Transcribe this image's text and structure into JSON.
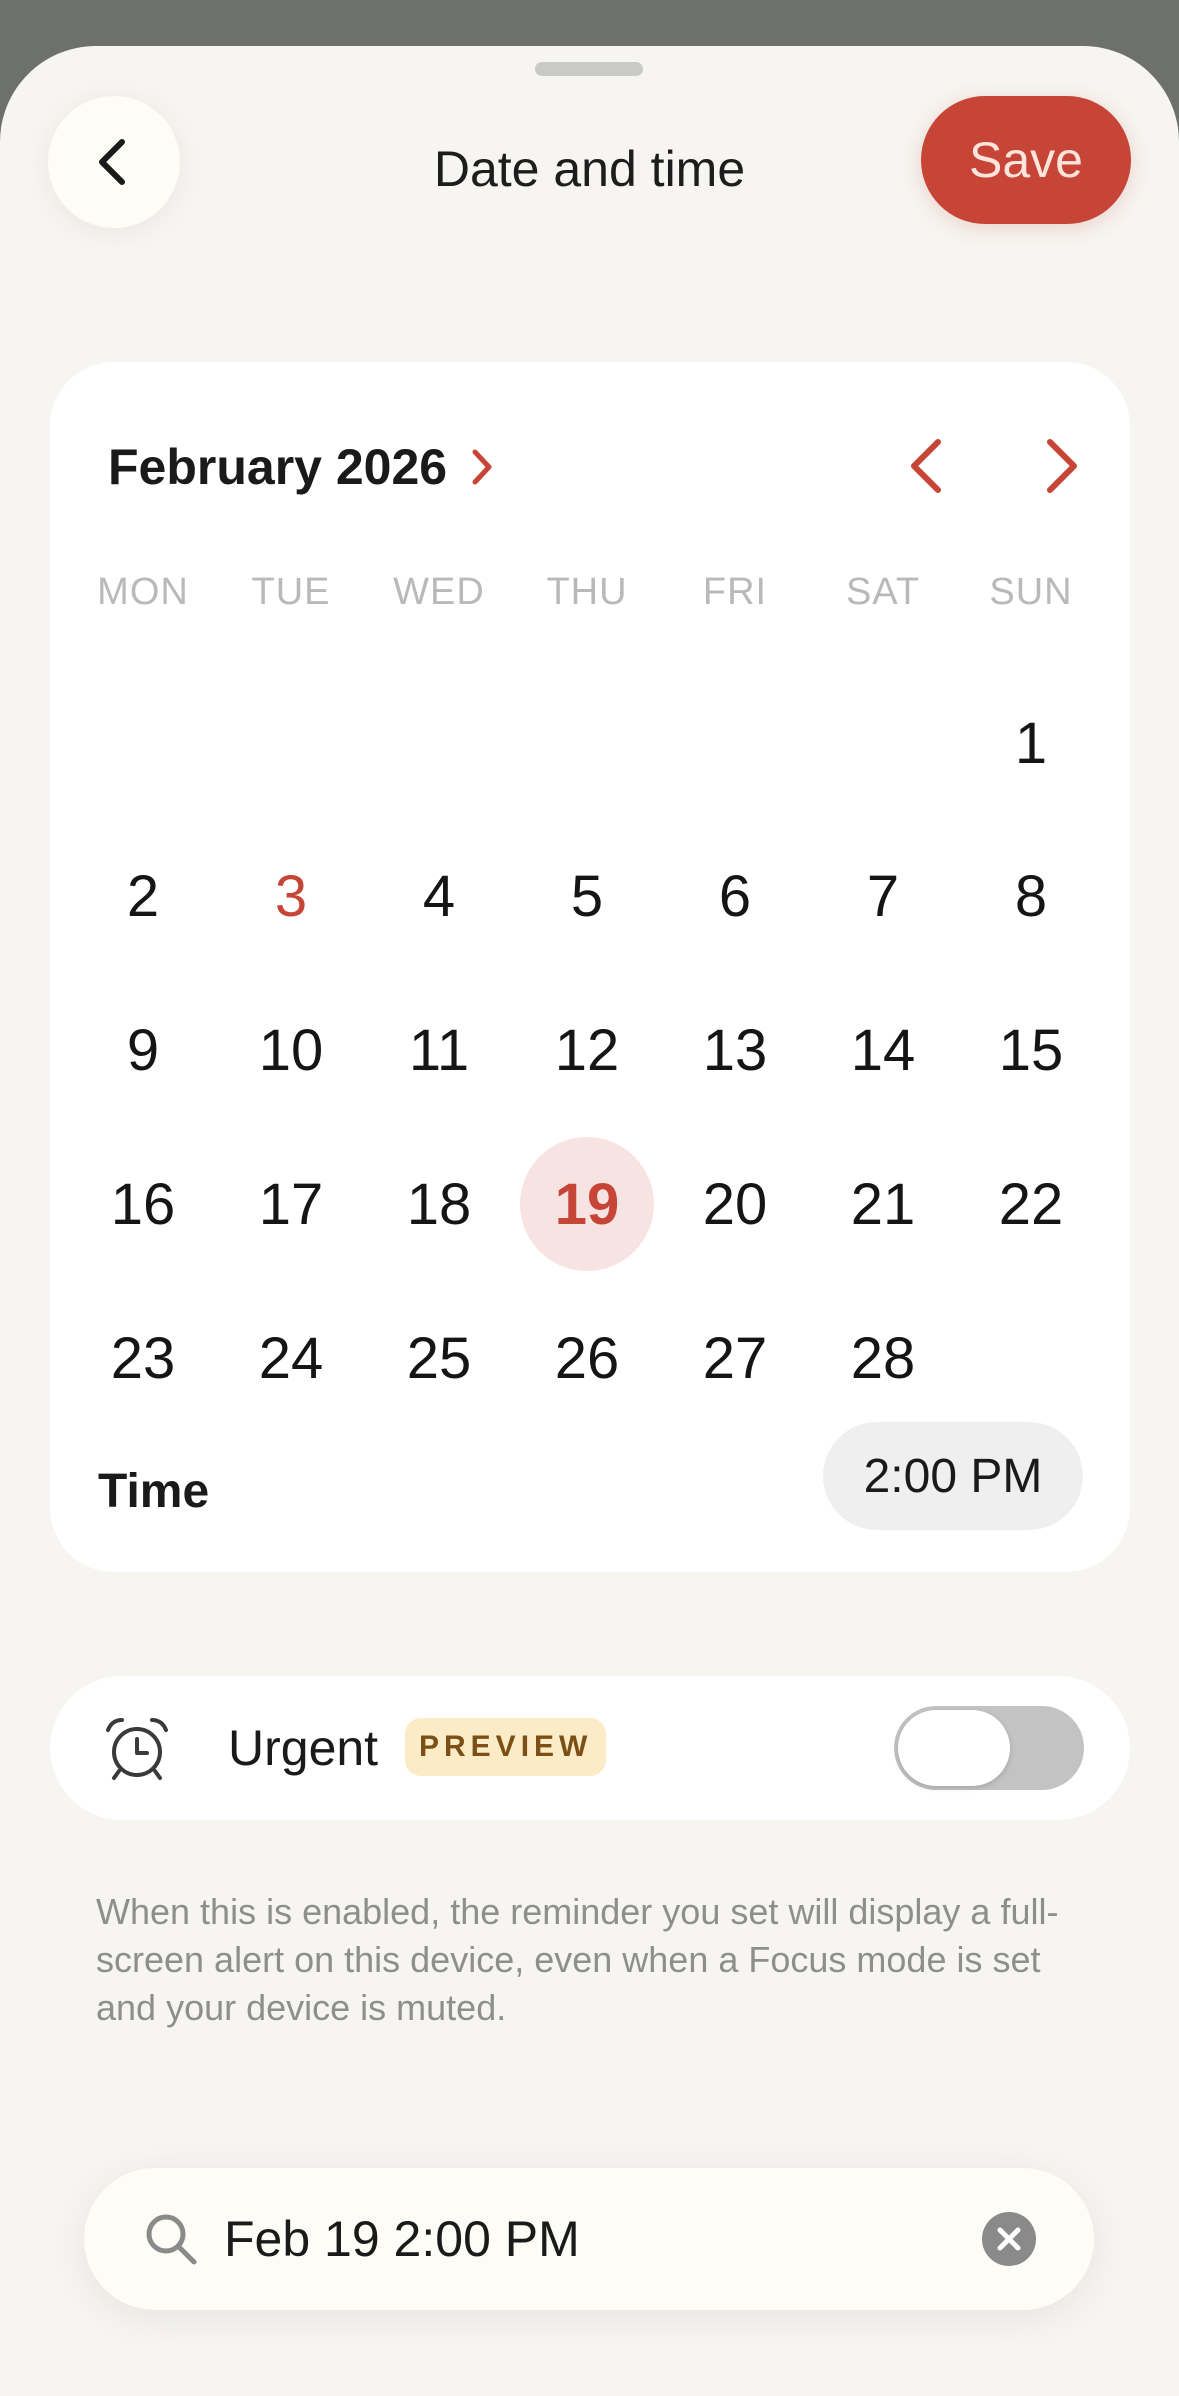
{
  "header": {
    "title": "Date and time",
    "save_label": "Save"
  },
  "calendar": {
    "month_label": "February 2026",
    "weekdays": [
      "MON",
      "TUE",
      "WED",
      "THU",
      "FRI",
      "SAT",
      "SUN"
    ],
    "days": [
      "1",
      "2",
      "3",
      "4",
      "5",
      "6",
      "7",
      "8",
      "9",
      "10",
      "11",
      "12",
      "13",
      "14",
      "15",
      "16",
      "17",
      "18",
      "19",
      "20",
      "21",
      "22",
      "23",
      "24",
      "25",
      "26",
      "27",
      "28"
    ],
    "today": "3",
    "selected": "19",
    "accent_color": "#c64536",
    "selected_bg": "#f7e3e1"
  },
  "time": {
    "label": "Time",
    "value": "2:00 PM"
  },
  "urgent": {
    "label": "Urgent",
    "badge": "PREVIEW",
    "enabled": false,
    "help_text": "When this is enabled, the reminder you set will display a full-screen alert on this device, even when a Focus mode is set and your device is muted."
  },
  "search": {
    "value": "Feb 19 2:00 PM"
  },
  "icons": {
    "back": "chevron-left-icon",
    "month_expand": "chevron-right-icon",
    "prev_month": "chevron-left-icon",
    "next_month": "chevron-right-icon",
    "alarm": "alarm-clock-icon",
    "search": "search-icon",
    "clear": "clear-icon"
  }
}
